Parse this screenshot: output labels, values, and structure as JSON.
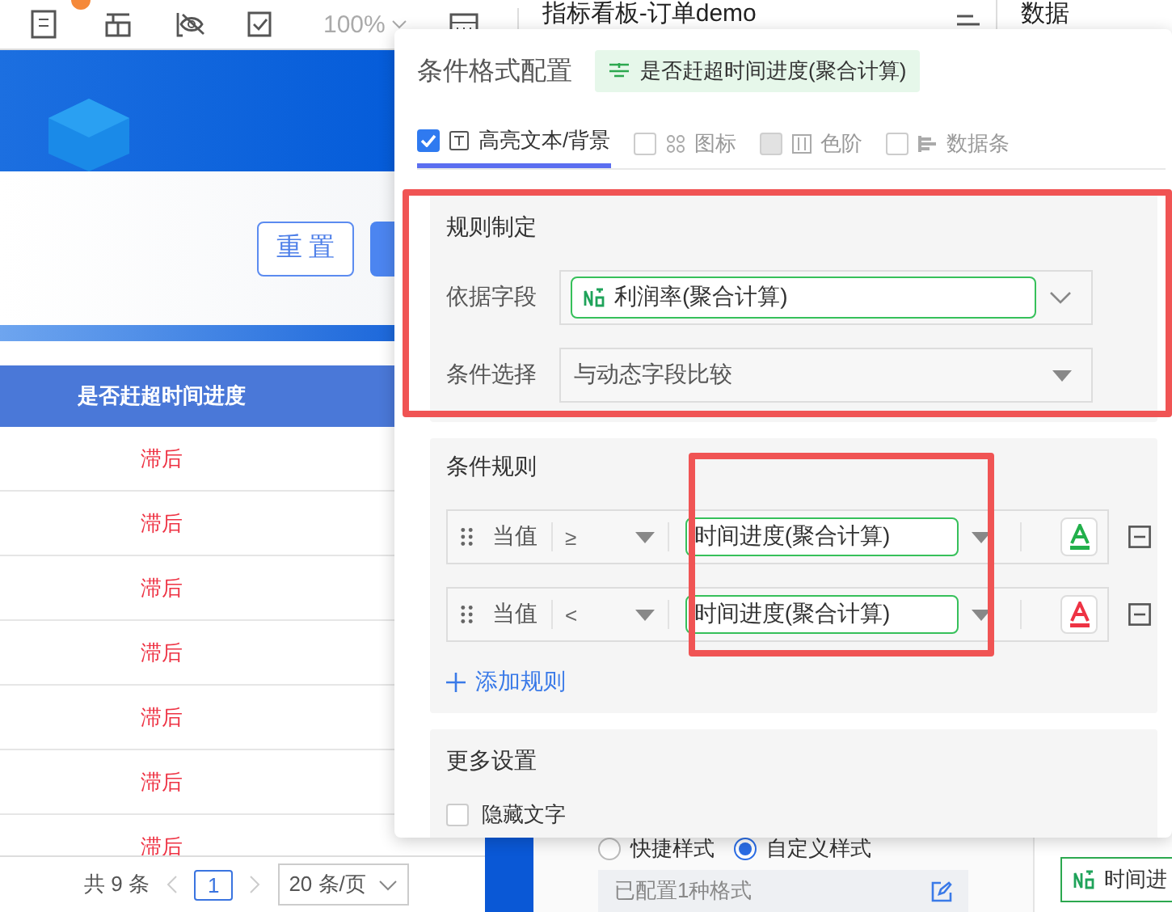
{
  "toolbar": {
    "zoom": "100%",
    "document_title": "指标看板-订单demo",
    "panel_title": "数据"
  },
  "filter_buttons": [
    {
      "label": "重 置"
    }
  ],
  "table": {
    "columns": [
      "是否赶超时间进度"
    ],
    "rows": [
      [
        "滞后"
      ],
      [
        "滞后"
      ],
      [
        "滞后"
      ],
      [
        "滞后"
      ],
      [
        "滞后"
      ],
      [
        "滞后"
      ],
      [
        "滞后"
      ]
    ]
  },
  "pagination": {
    "total": "共 9 条",
    "page": "1",
    "page_size": "20 条/页"
  },
  "style_options": [
    {
      "label": "快捷样式",
      "selected": false
    },
    {
      "label": "自定义样式",
      "selected": true
    }
  ],
  "configured": "已配置1种格式",
  "field_tag": "时间进",
  "dialog": {
    "title": "条件格式配置",
    "field": "是否赶超时间进度(聚合计算)",
    "tabs": [
      {
        "label": "高亮文本/背景",
        "checked": true,
        "selected": true,
        "disabled": false
      },
      {
        "label": "图标",
        "checked": false,
        "selected": false,
        "disabled": false
      },
      {
        "label": "色阶",
        "checked": false,
        "selected": false,
        "disabled": true
      },
      {
        "label": "数据条",
        "checked": false,
        "selected": false,
        "disabled": false
      }
    ],
    "rule_definition": {
      "title": "规则制定",
      "based_on_label": "依据字段",
      "based_on_value": "利润率(聚合计算)",
      "condition_label": "条件选择",
      "condition_value": "与动态字段比较"
    },
    "condition_rules": {
      "title": "条件规则",
      "rules": [
        {
          "subject": "当值",
          "operator": "≥",
          "compare_field": "时间进度(聚合计算)",
          "color": "#22b04b"
        },
        {
          "subject": "当值",
          "operator": "<",
          "compare_field": "时间进度(聚合计算)",
          "color": "#ee3344"
        }
      ],
      "add_label": "添加规则"
    },
    "more_settings": {
      "title": "更多设置",
      "options": [
        {
          "label": "隐藏文字",
          "checked": false
        }
      ]
    }
  }
}
